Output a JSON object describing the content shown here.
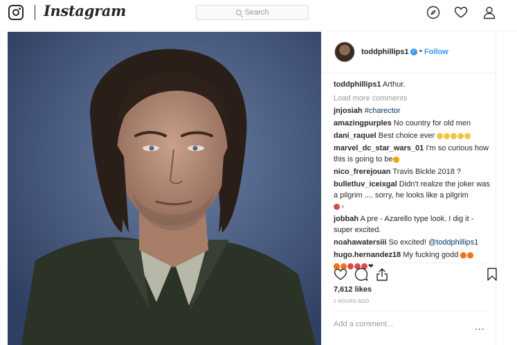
{
  "nav": {
    "brand": "Instagram",
    "search_placeholder": "Search",
    "icons": [
      "instagram-glyph-icon",
      "search-icon",
      "compass-icon",
      "heart-icon",
      "user-icon"
    ]
  },
  "post": {
    "author": "toddphillips1",
    "follow_label": "Follow",
    "dot": "•",
    "caption_user": "toddphillips1",
    "caption_text": " Arthur.",
    "load_more": "Load more comments",
    "comments": [
      {
        "user": "jnjosiah",
        "text": "",
        "tag": " #charector"
      },
      {
        "user": "amazingpurples",
        "text": " No country for old men"
      },
      {
        "user": "dani_raquel",
        "text": " Best choice ever"
      },
      {
        "user": "marvel_dc_star_wars_01",
        "text": " I'm so curious how this is going to be"
      },
      {
        "user": "nico_frerejouan",
        "text": " Travis Bickle 2018 ?"
      },
      {
        "user": "bulletluv_iceixgal",
        "text": " Didn't realize the joker was a pilgrim .... sorry, he looks like a pilgrim"
      },
      {
        "user": "jobbah",
        "text": " A pre - Azarello type look. I dig it - super excited."
      },
      {
        "user": "noahawatersiii",
        "text": " So excited! ",
        "tag": "@toddphillips1"
      },
      {
        "user": "hugo.hernandez18",
        "text": " My fucking godd"
      }
    ],
    "likes": "7,612 likes",
    "timestamp": "2 HOURS AGO",
    "add_comment_placeholder": "Add a comment...",
    "more_label": "..."
  },
  "colors": {
    "link_blue": "#3897f0",
    "border": "#efefef",
    "text": "#262626",
    "muted": "#999999",
    "photo_bg": "#3c4f76"
  }
}
